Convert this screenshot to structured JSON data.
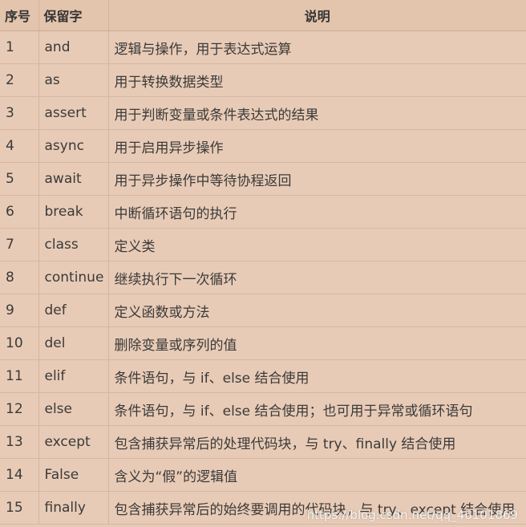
{
  "table": {
    "headers": [
      "序号",
      "保留字",
      "说明"
    ],
    "rows": [
      [
        "1",
        "and",
        "逻辑与操作，用于表达式运算"
      ],
      [
        "2",
        "as",
        "用于转换数据类型"
      ],
      [
        "3",
        "assert",
        "用于判断变量或条件表达式的结果"
      ],
      [
        "4",
        "async",
        "用于启用异步操作"
      ],
      [
        "5",
        "await",
        "用于异步操作中等待协程返回"
      ],
      [
        "6",
        "break",
        "中断循环语句的执行"
      ],
      [
        "7",
        "class",
        "定义类"
      ],
      [
        "8",
        "continue",
        "继续执行下一次循环"
      ],
      [
        "9",
        "def",
        "定义函数或方法"
      ],
      [
        "10",
        "del",
        "删除变量或序列的值"
      ],
      [
        "11",
        "elif",
        "条件语句，与 if、else 结合使用"
      ],
      [
        "12",
        "else",
        "条件语句，与 if、else 结合使用；也可用于异常或循环语句"
      ],
      [
        "13",
        "except",
        "包含捕获异常后的处理代码块，与 try、finally 结合使用"
      ],
      [
        "14",
        "False",
        "含义为“假”的逻辑值"
      ],
      [
        "15",
        "finally",
        "包含捕获异常后的始终要调用的代码块，与 try、except 结合使用"
      ]
    ]
  },
  "watermark": "https://blog.csdn.net/qq_46101869"
}
